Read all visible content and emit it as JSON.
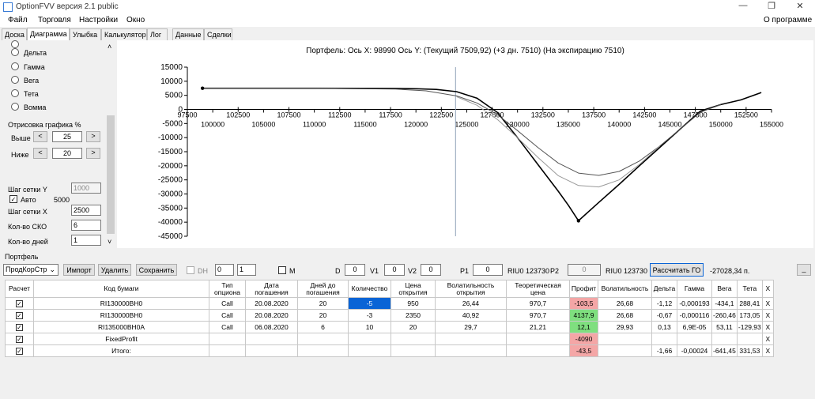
{
  "window": {
    "title": "OptionFVV версия 2.1 public",
    "btn_min": "—",
    "btn_max": "❐",
    "btn_close": "✕"
  },
  "menu": {
    "items": [
      "Файл",
      "Торговля",
      "Настройки",
      "Окно"
    ],
    "right": "О программе"
  },
  "tabs": [
    "Доска",
    "Диаграмма",
    "Улыбка",
    "Калькулятор",
    "Лог",
    "Данные",
    "Сделки"
  ],
  "left": {
    "radios": [
      "Дельта",
      "Гамма",
      "Вега",
      "Тета",
      "Вомма"
    ],
    "group_title": "Отрисовка графика %",
    "above_label": "Выше",
    "above_value": "25",
    "below_label": "Ниже",
    "below_value": "20",
    "arrow_left": "<",
    "arrow_right": ">",
    "grid_y_label": "Шаг сетки Y",
    "grid_y_value": "1000",
    "auto_label": "Авто",
    "auto_value": "5000",
    "grid_x_label": "Шаг сетки X",
    "grid_x_value": "2500",
    "sko_label": "Кол-во СКО",
    "sko_value": "6",
    "days_label": "Кол-во дней",
    "days_value": "1"
  },
  "chart_data": {
    "type": "line",
    "title": "Портфель: Ось X: 98990 Ось Y:  (Текущий 7509,92)  (+3 дн. 7510)  (На экспирацию 7510)",
    "xlim": [
      97500,
      155000
    ],
    "ylim": [
      -45000,
      15000
    ],
    "x_ticks_top": [
      97500,
      102500,
      107500,
      112500,
      117500,
      122500,
      127500,
      132500,
      137500,
      142500,
      147500,
      152500
    ],
    "x_ticks_bottom": [
      100000,
      105000,
      110000,
      115000,
      120000,
      125000,
      130000,
      135000,
      140000,
      145000,
      150000,
      155000
    ],
    "y_ticks": [
      15000,
      10000,
      5000,
      0,
      -5000,
      -10000,
      -15000,
      -20000,
      -25000,
      -30000,
      -35000,
      -40000,
      -45000
    ],
    "cursor_x": 123900,
    "series": [
      {
        "color": "#000000",
        "width": 1.6,
        "x": [
          98990,
          105000,
          110000,
          115000,
          118000,
          120000,
          122000,
          124000,
          126000,
          128000,
          130000,
          132000,
          134000,
          135000,
          136000,
          138000,
          140000,
          142000,
          144000,
          146000,
          148000,
          150000,
          152000,
          154000
        ],
        "y": [
          7510,
          7510,
          7510,
          7500,
          7450,
          7350,
          7100,
          6300,
          4000,
          -1000,
          -10000,
          -19500,
          -29000,
          -34000,
          -39500,
          -33000,
          -26600,
          -20000,
          -13500,
          -7000,
          -600,
          1700,
          3400,
          6000
        ]
      },
      {
        "color": "#555555",
        "width": 1.0,
        "x": [
          98990,
          110000,
          118000,
          121000,
          124000,
          126000,
          128000,
          130000,
          132000,
          134000,
          136000,
          138000,
          140000,
          142000,
          144000,
          146000,
          148000,
          150000
        ],
        "y": [
          7510,
          7500,
          7200,
          6600,
          4800,
          2300,
          -1800,
          -7500,
          -13500,
          -19000,
          -22600,
          -23400,
          -22000,
          -18300,
          -13000,
          -7000,
          -1000,
          1700
        ]
      },
      {
        "color": "#999999",
        "width": 1.0,
        "x": [
          124000,
          126000,
          128000,
          130000,
          132000,
          134000,
          136000,
          138000,
          140000,
          142000,
          144000
        ],
        "y": [
          4500,
          1500,
          -3500,
          -10000,
          -17000,
          -23500,
          -27000,
          -27500,
          -25000,
          -19500,
          -13000
        ]
      }
    ]
  },
  "portfolio": {
    "title": "Портфель",
    "strategy": "ПродКорСтр",
    "import": "Импорт",
    "delete": "Удалить",
    "save": "Сохранить",
    "dh_label": "DH",
    "spin1": "0",
    "spin2": "1",
    "m_label": "M",
    "d_label": "D",
    "d_value": "0",
    "v1_label": "V1",
    "v1_value": "0",
    "v2_label": "V2",
    "v2_value": "0",
    "p1_label": "P1",
    "p1_value": "0",
    "p1_code": "RIU0 123730",
    "p2_label": "P2",
    "p2_value": "0",
    "p2_code": "RIU0 123730",
    "go_button": "Рассчитать ГО",
    "go_value": "-27028,34 п.",
    "minimize": "_"
  },
  "table": {
    "headers": [
      "Расчет",
      "Код бумаги",
      "Тип опциона",
      "Дата погашения",
      "Дней до погашения",
      "Количество",
      "Цена открытия",
      "Волатильность открытия",
      "Теоретическая цена",
      "Профит",
      "Волатильность",
      "Дельта",
      "Гамма",
      "Вега",
      "Тета",
      "X"
    ],
    "rows": [
      [
        "☑",
        "RI130000BH0",
        "Call",
        "20.08.2020",
        "20",
        "-5",
        "950",
        "26,44",
        "970,7",
        "-103,5",
        "26,68",
        "-1,12",
        "-0,000193",
        "-434,1",
        "288,41",
        "X"
      ],
      [
        "☑",
        "RI130000BH0",
        "Call",
        "20.08.2020",
        "20",
        "-3",
        "2350",
        "40,92",
        "970,7",
        "4137,9",
        "26,68",
        "-0,67",
        "-0,000116",
        "-260,46",
        "173,05",
        "X"
      ],
      [
        "☑",
        "RI135000BH0A",
        "Call",
        "06.08.2020",
        "6",
        "10",
        "20",
        "29,7",
        "21,21",
        "12,1",
        "29,93",
        "0,13",
        "6,9E-05",
        "53,11",
        "-129,93",
        "X"
      ],
      [
        "☑",
        "FixedProfit",
        "",
        "",
        "",
        "",
        "",
        "",
        "",
        "-4090",
        "",
        "",
        "",
        "",
        "",
        "X"
      ],
      [
        "☑",
        "Итого:",
        "",
        "",
        "",
        "",
        "",
        "",
        "",
        "-43,5",
        "",
        "-1,66",
        "-0,00024",
        "-641,45",
        "331,53",
        "X"
      ]
    ],
    "profit_colors": [
      "#f4a6a6",
      "#7fdf7f",
      "#7fdf7f",
      "#f4a6a6",
      "#f4a6a6"
    ],
    "selected_color": "#0a64d6"
  }
}
